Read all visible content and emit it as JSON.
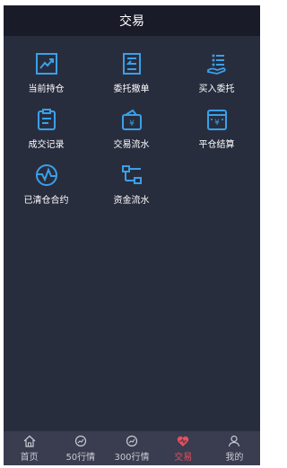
{
  "header": {
    "title": "交易"
  },
  "menu": [
    {
      "label": "当前持仓",
      "icon": "trend-chart-icon"
    },
    {
      "label": "委托撤单",
      "icon": "cancel-order-icon"
    },
    {
      "label": "买入委托",
      "icon": "buy-order-icon"
    },
    {
      "label": "成交记录",
      "icon": "clipboard-icon"
    },
    {
      "label": "交易流水",
      "icon": "wallet-icon"
    },
    {
      "label": "平仓结算",
      "icon": "settlement-icon"
    },
    {
      "label": "已清仓合约",
      "icon": "cleared-contract-icon"
    },
    {
      "label": "资金流水",
      "icon": "fund-flow-icon"
    }
  ],
  "tabs": [
    {
      "label": "首页",
      "icon": "home-icon"
    },
    {
      "label": "50行情",
      "icon": "market-50-icon"
    },
    {
      "label": "300行情",
      "icon": "market-300-icon"
    },
    {
      "label": "交易",
      "icon": "trade-icon",
      "active": true
    },
    {
      "label": "我的",
      "icon": "user-icon"
    }
  ],
  "colors": {
    "accent": "#3aa0e8",
    "active_tab": "#e8505b",
    "background": "#282d3e",
    "header": "#191c28"
  }
}
